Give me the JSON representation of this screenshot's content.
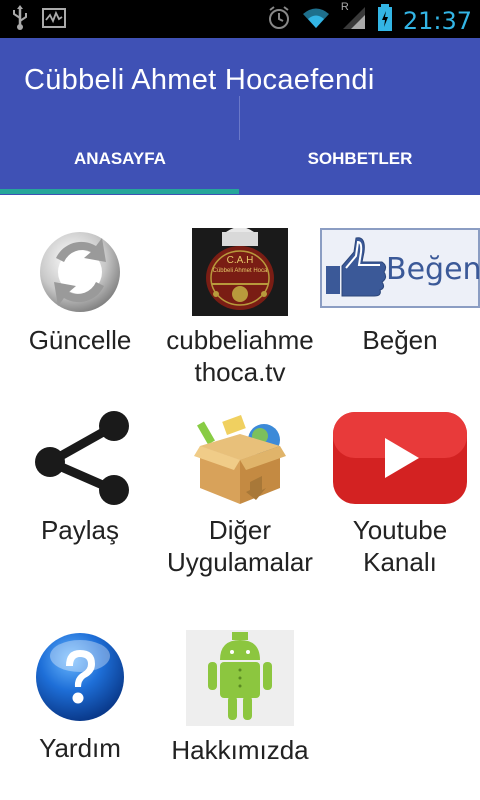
{
  "status_bar": {
    "time": "21:37",
    "icons": [
      "usb-icon",
      "monitor-icon",
      "alarm-icon",
      "wifi-icon",
      "signal-icon",
      "battery-icon"
    ],
    "roaming_letter": "R"
  },
  "app_bar": {
    "title": "Cübbeli Ahmet Hocaefendi",
    "background": "#3f51b5",
    "tabs": [
      {
        "label": "ANASAYFA",
        "selected": true
      },
      {
        "label": "SOHBETLER",
        "selected": false
      }
    ],
    "indicator_color": "#26a69a"
  },
  "grid": {
    "items": [
      {
        "label": "Güncelle",
        "icon": "refresh-icon"
      },
      {
        "label": "cubbeliahme thoca.tv",
        "line1": "cubbeliahme",
        "line2": "thoca.tv",
        "icon": "cah-logo-icon",
        "logo_line1": "C.A.H",
        "logo_line2": "Cübbeli Ahmet Hoca"
      },
      {
        "label": "Beğen",
        "icon": "facebook-like-icon",
        "badge_text": "Beğen"
      },
      {
        "label": "Paylaş",
        "icon": "share-icon"
      },
      {
        "label": "Diğer Uygulamalar",
        "line1": "Diğer",
        "line2": "Uygulamalar",
        "icon": "package-box-icon"
      },
      {
        "label": "Youtube Kanalı",
        "line1": "Youtube",
        "line2": "Kanalı",
        "icon": "youtube-icon"
      },
      {
        "label": "Yardım",
        "icon": "help-icon"
      },
      {
        "label": "Hakkımızda",
        "icon": "android-icon"
      }
    ]
  }
}
